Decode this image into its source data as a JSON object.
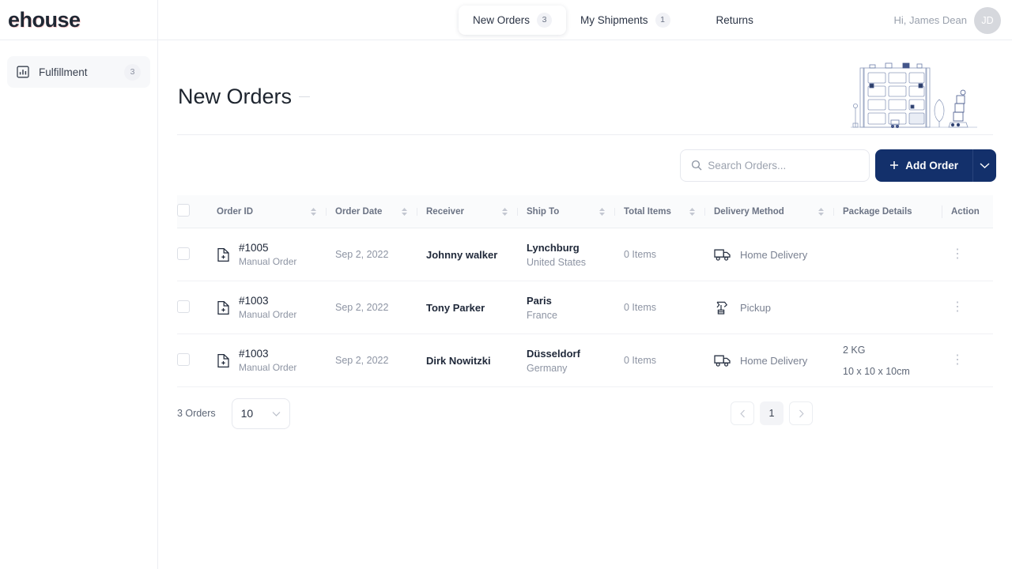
{
  "brand": {
    "logo_text": "ehouse"
  },
  "header": {
    "tabs": [
      {
        "label": "New Orders",
        "count": "3",
        "active": true
      },
      {
        "label": "My Shipments",
        "count": "1",
        "active": false
      },
      {
        "label": "Returns",
        "count": "",
        "active": false
      }
    ],
    "greeting": "Hi, James Dean",
    "avatar_initials": "JD"
  },
  "sidebar": {
    "items": [
      {
        "label": "Fulfillment",
        "count": "3",
        "icon": "bar-chart-icon"
      }
    ]
  },
  "page": {
    "title": "New Orders"
  },
  "toolbar": {
    "search_placeholder": "Search Orders...",
    "search_value": "",
    "add_order_label": "Add Order",
    "search_icon": "search-icon",
    "plus_icon": "plus-icon",
    "caret_icon": "chevron-down-icon"
  },
  "table": {
    "columns": [
      {
        "label": "Order ID",
        "sortable": true
      },
      {
        "label": "Order Date",
        "sortable": true
      },
      {
        "label": "Receiver",
        "sortable": true
      },
      {
        "label": "Ship To",
        "sortable": true
      },
      {
        "label": "Total Items",
        "sortable": true
      },
      {
        "label": "Delivery Method",
        "sortable": true
      },
      {
        "label": "Package Details",
        "sortable": false
      },
      {
        "label": "Action",
        "sortable": false
      }
    ],
    "rows": [
      {
        "order_id": "#1005",
        "order_type": "Manual Order",
        "order_date": "Sep 2, 2022",
        "receiver": "Johnny walker",
        "ship_city": "Lynchburg",
        "ship_country": "United States",
        "total_items": "0 Items",
        "delivery_method": "Home Delivery",
        "delivery_icon": "truck-icon",
        "package_weight": "",
        "package_dims": ""
      },
      {
        "order_id": "#1003",
        "order_type": "Manual Order",
        "order_date": "Sep 2, 2022",
        "receiver": "Tony Parker",
        "ship_city": "Paris",
        "ship_country": "France",
        "total_items": "0 Items",
        "delivery_method": "Pickup",
        "delivery_icon": "pickup-icon",
        "package_weight": "",
        "package_dims": ""
      },
      {
        "order_id": "#1003",
        "order_type": "Manual Order",
        "order_date": "Sep 2, 2022",
        "receiver": "Dirk Nowitzki",
        "ship_city": "Düsseldorf",
        "ship_country": "Germany",
        "total_items": "0 Items",
        "delivery_method": "Home Delivery",
        "delivery_icon": "truck-icon",
        "package_weight": "2 KG",
        "package_dims": "10 x 10 x 10cm"
      }
    ]
  },
  "footer": {
    "order_count": "3 Orders",
    "per_page": "10",
    "pages": [
      "1"
    ],
    "prev_icon": "chevron-left-icon",
    "next_icon": "chevron-right-icon"
  },
  "colors": {
    "primary": "#13306b",
    "text": "#20293a",
    "muted": "#8d94a3",
    "border": "#eceef2",
    "illustration": "#3c4f7a"
  }
}
